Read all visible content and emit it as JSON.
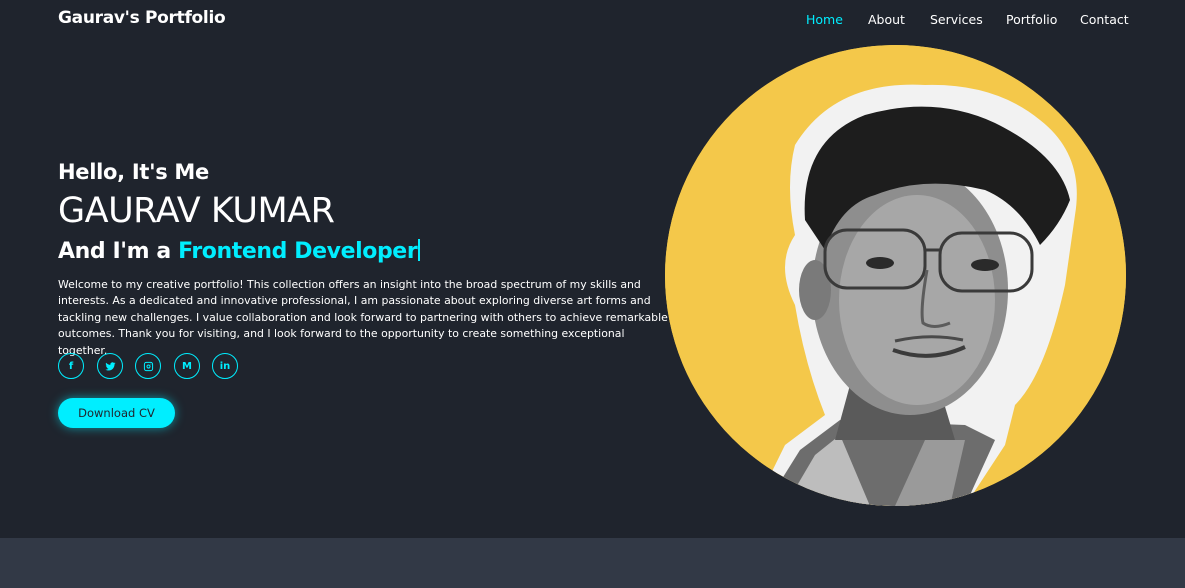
{
  "header": {
    "logo": "Gaurav's Portfolio",
    "nav": [
      {
        "label": "Home",
        "active": true
      },
      {
        "label": "About",
        "active": false
      },
      {
        "label": "Services",
        "active": false
      },
      {
        "label": "Portfolio",
        "active": false
      },
      {
        "label": "Contact",
        "active": false
      }
    ]
  },
  "hero": {
    "greeting": "Hello, It's Me",
    "name": "GAURAV KUMAR",
    "role_prefix": "And I'm a ",
    "role": "Frontend Developer",
    "bio": "Welcome to my creative portfolio! This collection offers an insight into the broad spectrum of my skills and interests. As a dedicated and innovative professional, I am passionate about exploring diverse art forms and tackling new challenges. I value collaboration and look forward to partnering with others to achieve remarkable outcomes. Thank you for visiting, and I look forward to the opportunity to create something exceptional together.",
    "socials": [
      {
        "icon": "facebook-icon",
        "glyph": "f"
      },
      {
        "icon": "twitter-icon",
        "glyph": ""
      },
      {
        "icon": "instagram-icon",
        "glyph": ""
      },
      {
        "icon": "medium-icon",
        "glyph": "M"
      },
      {
        "icon": "linkedin-icon",
        "glyph": "in"
      }
    ],
    "cta_label": "Download CV"
  },
  "colors": {
    "background": "#1f242d",
    "accent": "#0ef",
    "photo_background": "#f4c84a",
    "footer_band": "#323946"
  }
}
